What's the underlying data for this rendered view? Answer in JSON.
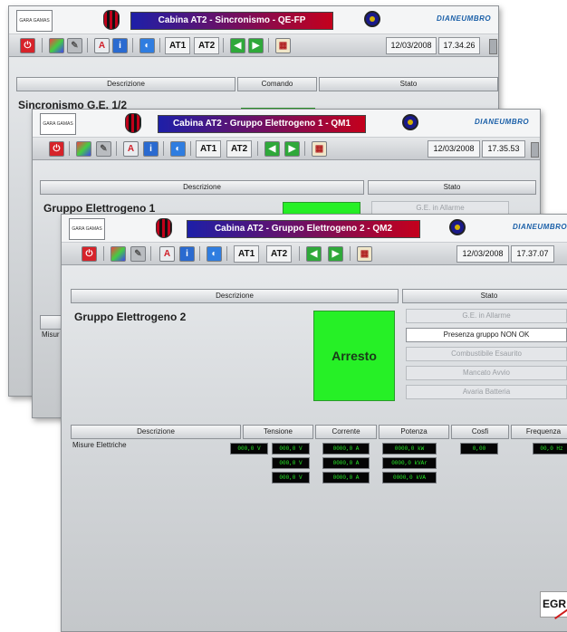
{
  "windows": [
    {
      "title": "Cabina AT2 - Sincronismo - QE-FP",
      "logo_text": "GARA GAMAS",
      "brand": "DIANEUMBRO",
      "toolbar": {
        "at1": "AT1",
        "at2": "AT2",
        "date": "12/03/2008",
        "time": "17.34.26"
      },
      "columns": [
        "Descrizione",
        "Comando",
        "Stato"
      ],
      "section": "Sincronismo G.E. 1/2"
    },
    {
      "title": "Cabina AT2 - Gruppo Elettrogeno 1 - QM1",
      "logo_text": "GARA GAMAS",
      "brand": "DIANEUMBRO",
      "toolbar": {
        "at1": "AT1",
        "at2": "AT2",
        "date": "12/03/2008",
        "time": "17.35.53"
      },
      "columns": [
        "Descrizione",
        "Stato"
      ],
      "section": "Gruppo Elettrogeno 1",
      "status_items": [
        "G.E. in Allarme"
      ],
      "partial_labels": [
        "Misur"
      ]
    },
    {
      "title": "Cabina AT2 - Gruppo Elettrogeno 2 - QM2",
      "logo_text": "GARA GAMAS",
      "brand": "DIANEUMBRO",
      "toolbar": {
        "at1": "AT1",
        "at2": "AT2",
        "date": "12/03/2008",
        "time": "17.37.07"
      },
      "columns": [
        "Descrizione",
        "Stato"
      ],
      "section": "Gruppo Elettrogeno 2",
      "command": "Arresto",
      "status_items": [
        {
          "label": "G.E. in Allarme",
          "active": false
        },
        {
          "label": "Presenza gruppo NON OK",
          "active": true
        },
        {
          "label": "Combustibile Esaurito",
          "active": false
        },
        {
          "label": "Mancato Avvio",
          "active": false
        },
        {
          "label": "Avaria Batteria",
          "active": false
        }
      ],
      "measure_columns": [
        "Descrizione",
        "Tensione",
        "Corrente",
        "Potenza",
        "Cosfi",
        "Frequenza"
      ],
      "measure_row_label": "Misure Elettriche",
      "measures": {
        "tensione": [
          "000,0 V",
          "000,0 V",
          "000,0 V",
          "000,0 V"
        ],
        "corrente": [
          "0000,0 A",
          "0000,0 A",
          "0000,0 A"
        ],
        "potenza": [
          "0000,0 kW",
          "0000,0 kVAr",
          "0000,0 kVA"
        ],
        "cosfi": [
          "0,00"
        ],
        "frequenza": [
          "00,0 Hz"
        ]
      }
    }
  ],
  "corner_logo": "EGR"
}
